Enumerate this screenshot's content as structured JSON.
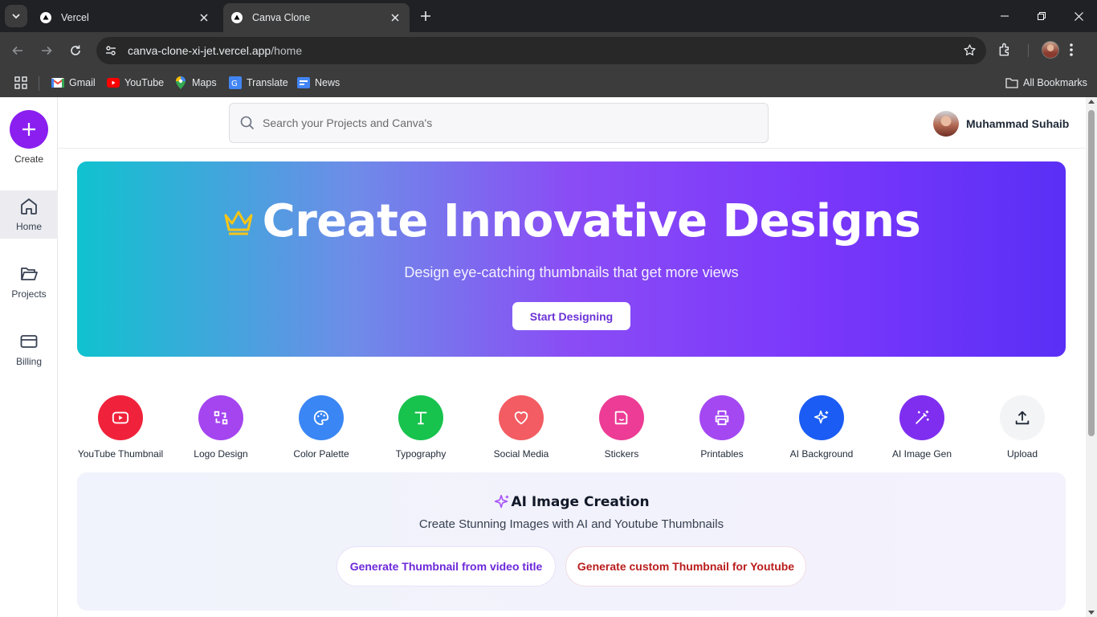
{
  "browser": {
    "tabs": [
      {
        "title": "Vercel",
        "active": false
      },
      {
        "title": "Canva Clone",
        "active": true
      }
    ],
    "url": {
      "host": "canva-clone-xi-jet.vercel.app",
      "path": "/home"
    },
    "bookmarks": [
      {
        "label": "Gmail",
        "icon": "gmail-icon"
      },
      {
        "label": "YouTube",
        "icon": "youtube-icon"
      },
      {
        "label": "Maps",
        "icon": "maps-icon"
      },
      {
        "label": "Translate",
        "icon": "translate-icon"
      },
      {
        "label": "News",
        "icon": "news-icon"
      }
    ],
    "all_bookmarks": "All Bookmarks"
  },
  "sidebar": {
    "create_label": "Create",
    "items": [
      {
        "label": "Home",
        "icon": "home-icon",
        "active": true
      },
      {
        "label": "Projects",
        "icon": "folder-icon",
        "active": false
      },
      {
        "label": "Billing",
        "icon": "card-icon",
        "active": false
      }
    ]
  },
  "header": {
    "search_placeholder": "Search your Projects and Canva's",
    "user_name": "Muhammad Suhaib"
  },
  "hero": {
    "title": "Create Innovative Designs",
    "subtitle": "Design eye-catching thumbnails that get more views",
    "button": "Start Designing"
  },
  "categories": [
    {
      "label": "YouTube Thumbnail",
      "icon": "youtube-icon",
      "color": "#f0223b"
    },
    {
      "label": "Logo Design",
      "icon": "swap-icon",
      "color": "#a445f0"
    },
    {
      "label": "Color Palette",
      "icon": "palette-icon",
      "color": "#3a86f4"
    },
    {
      "label": "Typography",
      "icon": "type-icon",
      "color": "#17c24d"
    },
    {
      "label": "Social Media",
      "icon": "heart-icon",
      "color": "#f25c62"
    },
    {
      "label": "Stickers",
      "icon": "sticker-icon",
      "color": "#ec3c95"
    },
    {
      "label": "Printables",
      "icon": "printer-icon",
      "color": "#a448f2"
    },
    {
      "label": "AI Background",
      "icon": "sparkles-icon",
      "color": "#1a5cf4"
    },
    {
      "label": "AI Image Gen",
      "icon": "magic-wand-icon",
      "color": "#7f2ef0"
    },
    {
      "label": "Upload",
      "icon": "upload-icon",
      "color": "#f3f4f6"
    }
  ],
  "ai_section": {
    "title": "AI Image Creation",
    "subtitle": "Create Stunning Images with AI and Youtube Thumbnails",
    "buttons": [
      "Generate Thumbnail from video title",
      "Generate custom Thumbnail for Youtube"
    ]
  }
}
